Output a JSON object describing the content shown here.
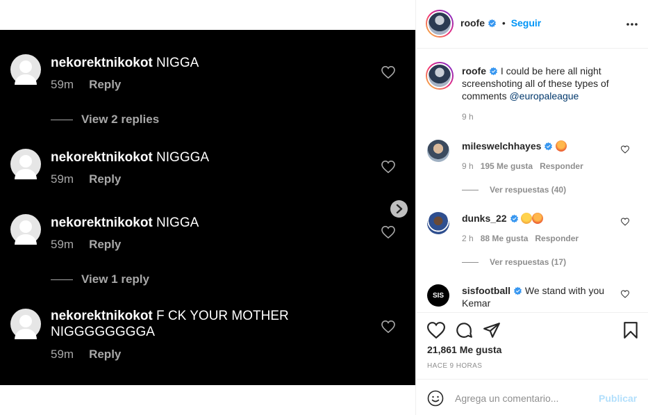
{
  "media": {
    "comments": [
      {
        "username": "nekorektnikokot",
        "text": "NIGGA",
        "time": "59m",
        "reply": "Reply"
      },
      {
        "username": "nekorektnikokot",
        "text": "NIGGGA",
        "time": "59m",
        "reply": "Reply"
      },
      {
        "username": "nekorektnikokot",
        "text": "NIGGA",
        "time": "59m",
        "reply": "Reply"
      },
      {
        "username": "nekorektnikokot",
        "text": "F   CK YOUR MOTHER NIGGGGGGGGA",
        "time": "59m",
        "reply": "Reply"
      }
    ],
    "view_replies_1": "View 2 replies",
    "view_replies_2": "View 1 reply"
  },
  "header": {
    "username": "roofe",
    "separator": "•",
    "follow_label": "Seguir"
  },
  "caption": {
    "username": "roofe",
    "text": "I could be here all night screenshoting all of these types of comments",
    "mention": "@europaleague",
    "time": "9 h"
  },
  "comments": [
    {
      "username": "mileswelchhayes",
      "text": "",
      "time": "9 h",
      "likes": "195 Me gusta",
      "reply": "Responder",
      "view_replies": "Ver respuestas (40)"
    },
    {
      "username": "dunks_22",
      "text": "",
      "time": "2 h",
      "likes": "88 Me gusta",
      "reply": "Responder",
      "view_replies": "Ver respuestas (17)"
    },
    {
      "username": "sisfootball",
      "text": "We stand with you Kemar"
    }
  ],
  "footer": {
    "likes": "21,861 Me gusta",
    "ago": "HACE 9 HORAS",
    "comment_placeholder": "Agrega un comentario...",
    "publish_label": "Publicar"
  },
  "colors": {
    "accent": "#0095f6",
    "verified": "#3897f0",
    "media_bg": "#000000"
  }
}
